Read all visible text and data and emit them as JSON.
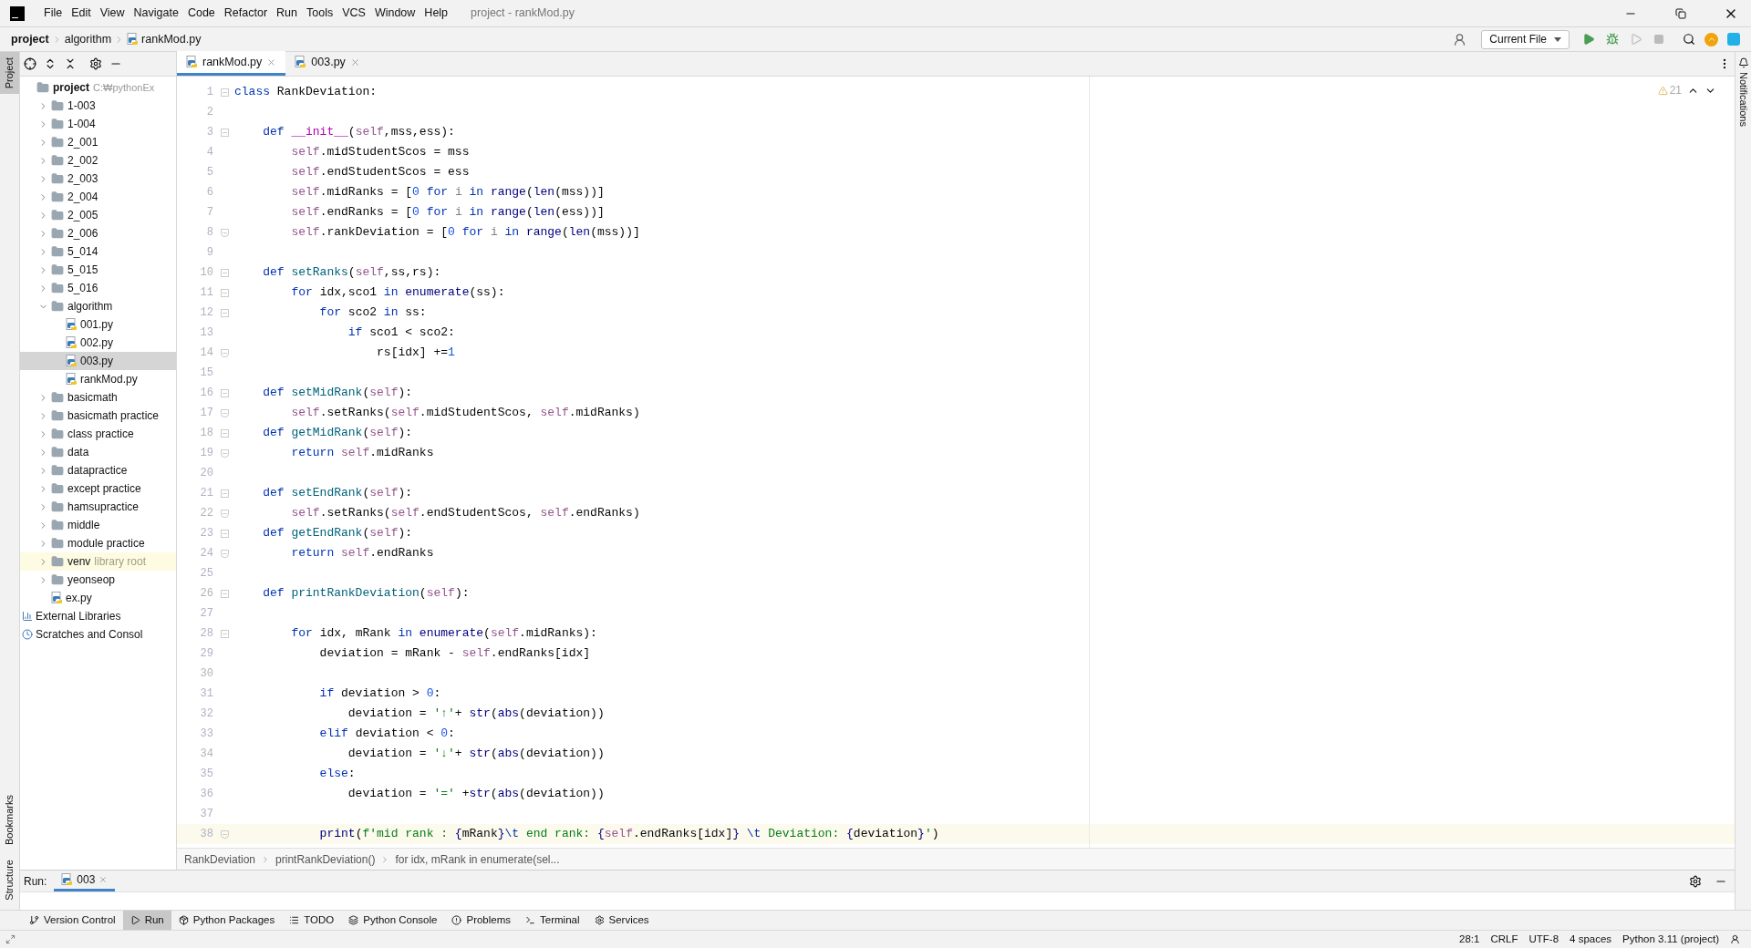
{
  "title_bar": {
    "menu": [
      "File",
      "Edit",
      "View",
      "Navigate",
      "Code",
      "Refactor",
      "Run",
      "Tools",
      "VCS",
      "Window",
      "Help"
    ],
    "title": "project - rankMod.py"
  },
  "nav_bar": {
    "breadcrumbs": [
      "project",
      "algorithm",
      "rankMod.py"
    ],
    "run_config": "Current File"
  },
  "left_strip": {
    "top": [
      "Project"
    ],
    "bottom": [
      "Bookmarks",
      "Structure"
    ]
  },
  "project_tree": {
    "label": "project",
    "path": "C:₩pythonEx",
    "children": [
      {
        "kind": "folder",
        "label": "1-003",
        "expanded": false,
        "selected": false
      },
      {
        "kind": "folder",
        "label": "1-004",
        "expanded": false,
        "selected": false
      },
      {
        "kind": "folder",
        "label": "2_001",
        "expanded": false,
        "selected": false
      },
      {
        "kind": "folder",
        "label": "2_002",
        "expanded": false,
        "selected": false
      },
      {
        "kind": "folder",
        "label": "2_003",
        "expanded": false,
        "selected": false
      },
      {
        "kind": "folder",
        "label": "2_004",
        "expanded": false,
        "selected": false
      },
      {
        "kind": "folder",
        "label": "2_005",
        "expanded": false,
        "selected": false
      },
      {
        "kind": "folder",
        "label": "2_006",
        "expanded": false,
        "selected": false
      },
      {
        "kind": "folder",
        "label": "5_014",
        "expanded": false,
        "selected": false
      },
      {
        "kind": "folder",
        "label": "5_015",
        "expanded": false,
        "selected": false
      },
      {
        "kind": "folder",
        "label": "5_016",
        "expanded": false,
        "selected": false
      },
      {
        "kind": "folder",
        "label": "algorithm",
        "expanded": true,
        "selected": false,
        "children": [
          {
            "kind": "file",
            "label": "001.py",
            "selected": false
          },
          {
            "kind": "file",
            "label": "002.py",
            "selected": false
          },
          {
            "kind": "file",
            "label": "003.py",
            "selected": true
          },
          {
            "kind": "file",
            "label": "rankMod.py",
            "selected": false
          }
        ]
      },
      {
        "kind": "folder",
        "label": "basicmath",
        "expanded": false,
        "selected": false
      },
      {
        "kind": "folder",
        "label": "basicmath practice",
        "expanded": false,
        "selected": false
      },
      {
        "kind": "folder",
        "label": "class practice",
        "expanded": false,
        "selected": false
      },
      {
        "kind": "folder",
        "label": "data",
        "expanded": false,
        "selected": false
      },
      {
        "kind": "folder",
        "label": "datapractice",
        "expanded": false,
        "selected": false
      },
      {
        "kind": "folder",
        "label": "except practice",
        "expanded": false,
        "selected": false
      },
      {
        "kind": "folder",
        "label": "hamsupractice",
        "expanded": false,
        "selected": false
      },
      {
        "kind": "folder",
        "label": "middle",
        "expanded": false,
        "selected": false
      },
      {
        "kind": "folder",
        "label": "module practice",
        "expanded": false,
        "selected": false
      },
      {
        "kind": "folder",
        "label": "venv",
        "note": "library root",
        "expanded": false,
        "selected": false
      },
      {
        "kind": "folder",
        "label": "yeonseop",
        "expanded": false,
        "selected": false
      },
      {
        "kind": "file",
        "label": "ex.py",
        "selected": false
      }
    ]
  },
  "extra_tree": [
    {
      "kind": "libraries",
      "label": "External Libraries"
    },
    {
      "kind": "scratches",
      "label": "Scratches and Consol"
    }
  ],
  "tabs": [
    {
      "label": "rankMod.py",
      "selected": true
    },
    {
      "label": "003.py",
      "selected": false
    }
  ],
  "editor": {
    "warnings": "21",
    "lines": [
      {
        "n": "1",
        "kind": "foldstart",
        "tokens": [
          {
            "kind": "keyword",
            "text": "class"
          },
          {
            "kind": "plain",
            "text": " RankDeviation:"
          }
        ]
      },
      {
        "n": "2",
        "kind": "blank"
      },
      {
        "n": "3",
        "kind": "foldstart",
        "tokens": [
          {
            "kind": "keyword",
            "text": "    def"
          },
          {
            "kind": "magic",
            "text": " __init__"
          },
          {
            "kind": "plain",
            "text": "("
          },
          {
            "kind": "self",
            "text": "self"
          },
          {
            "kind": "plain",
            "text": ",mss,ess):"
          }
        ]
      },
      {
        "n": "4",
        "kind": "plain",
        "tokens": [
          {
            "kind": "self",
            "text": "        self"
          },
          {
            "kind": "plain",
            "text": ".midStudentScos = mss"
          }
        ]
      },
      {
        "n": "5",
        "kind": "plain",
        "tokens": [
          {
            "kind": "self",
            "text": "        self"
          },
          {
            "kind": "plain",
            "text": ".endStudentScos = ess"
          }
        ]
      },
      {
        "n": "6",
        "kind": "plain",
        "tokens": [
          {
            "kind": "self",
            "text": "        self"
          },
          {
            "kind": "plain",
            "text": ".midRanks = ["
          },
          {
            "kind": "number",
            "text": "0"
          },
          {
            "kind": "keyword",
            "text": " for"
          },
          {
            "kind": "unused",
            "text": " i"
          },
          {
            "kind": "keyword",
            "text": " in"
          },
          {
            "kind": "builtin",
            "text": " range"
          },
          {
            "kind": "plain",
            "text": "("
          },
          {
            "kind": "builtin",
            "text": "len"
          },
          {
            "kind": "plain",
            "text": "(mss))]"
          }
        ]
      },
      {
        "n": "7",
        "kind": "plain",
        "tokens": [
          {
            "kind": "self",
            "text": "        self"
          },
          {
            "kind": "plain",
            "text": ".endRanks = ["
          },
          {
            "kind": "number",
            "text": "0"
          },
          {
            "kind": "keyword",
            "text": " for"
          },
          {
            "kind": "unused",
            "text": " i"
          },
          {
            "kind": "keyword",
            "text": " in"
          },
          {
            "kind": "builtin",
            "text": " range"
          },
          {
            "kind": "plain",
            "text": "("
          },
          {
            "kind": "builtin",
            "text": "len"
          },
          {
            "kind": "plain",
            "text": "(ess))]"
          }
        ]
      },
      {
        "n": "8",
        "kind": "foldend",
        "tokens": [
          {
            "kind": "self",
            "text": "        self"
          },
          {
            "kind": "plain",
            "text": ".rankDeviation = ["
          },
          {
            "kind": "number",
            "text": "0"
          },
          {
            "kind": "keyword",
            "text": " for"
          },
          {
            "kind": "unused",
            "text": " i"
          },
          {
            "kind": "keyword",
            "text": " in"
          },
          {
            "kind": "builtin",
            "text": " range"
          },
          {
            "kind": "plain",
            "text": "("
          },
          {
            "kind": "builtin",
            "text": "len"
          },
          {
            "kind": "plain",
            "text": "(mss))]"
          }
        ]
      },
      {
        "n": "9",
        "kind": "blank"
      },
      {
        "n": "10",
        "kind": "foldstart",
        "tokens": [
          {
            "kind": "keyword",
            "text": "    def"
          },
          {
            "kind": "function",
            "text": " setRanks"
          },
          {
            "kind": "plain",
            "text": "("
          },
          {
            "kind": "self",
            "text": "self"
          },
          {
            "kind": "plain",
            "text": ",ss,rs):"
          }
        ]
      },
      {
        "n": "11",
        "kind": "foldstart",
        "tokens": [
          {
            "kind": "keyword",
            "text": "        for"
          },
          {
            "kind": "plain",
            "text": " idx,sco1 "
          },
          {
            "kind": "keyword",
            "text": "in"
          },
          {
            "kind": "builtin",
            "text": " enumerate"
          },
          {
            "kind": "plain",
            "text": "(ss):"
          }
        ]
      },
      {
        "n": "12",
        "kind": "foldstart",
        "tokens": [
          {
            "kind": "keyword",
            "text": "            for"
          },
          {
            "kind": "plain",
            "text": " sco2 "
          },
          {
            "kind": "keyword",
            "text": "in"
          },
          {
            "kind": "plain",
            "text": " ss:"
          }
        ]
      },
      {
        "n": "13",
        "kind": "plain",
        "tokens": [
          {
            "kind": "keyword",
            "text": "                if"
          },
          {
            "kind": "plain",
            "text": " sco1 < sco2:"
          }
        ]
      },
      {
        "n": "14",
        "kind": "foldend",
        "tokens": [
          {
            "kind": "plain",
            "text": "                    rs[idx] +="
          },
          {
            "kind": "number",
            "text": "1"
          }
        ]
      },
      {
        "n": "15",
        "kind": "blank"
      },
      {
        "n": "16",
        "kind": "foldstart",
        "tokens": [
          {
            "kind": "keyword",
            "text": "    def"
          },
          {
            "kind": "function",
            "text": " setMidRank"
          },
          {
            "kind": "plain",
            "text": "("
          },
          {
            "kind": "self",
            "text": "self"
          },
          {
            "kind": "plain",
            "text": "):"
          }
        ]
      },
      {
        "n": "17",
        "kind": "foldend",
        "tokens": [
          {
            "kind": "self",
            "text": "        self"
          },
          {
            "kind": "plain",
            "text": ".setRanks("
          },
          {
            "kind": "self",
            "text": "self"
          },
          {
            "kind": "plain",
            "text": ".midStudentScos,"
          },
          {
            "kind": "self",
            "text": " self"
          },
          {
            "kind": "plain",
            "text": ".midRanks)"
          }
        ]
      },
      {
        "n": "18",
        "kind": "foldstart",
        "tokens": [
          {
            "kind": "keyword",
            "text": "    def"
          },
          {
            "kind": "function",
            "text": " getMidRank"
          },
          {
            "kind": "plain",
            "text": "("
          },
          {
            "kind": "self",
            "text": "self"
          },
          {
            "kind": "plain",
            "text": "):"
          }
        ]
      },
      {
        "n": "19",
        "kind": "foldend",
        "tokens": [
          {
            "kind": "keyword",
            "text": "        return"
          },
          {
            "kind": "self",
            "text": " self"
          },
          {
            "kind": "plain",
            "text": ".midRanks"
          }
        ]
      },
      {
        "n": "20",
        "kind": "blank"
      },
      {
        "n": "21",
        "kind": "foldstart",
        "tokens": [
          {
            "kind": "keyword",
            "text": "    def"
          },
          {
            "kind": "function",
            "text": " setEndRank"
          },
          {
            "kind": "plain",
            "text": "("
          },
          {
            "kind": "self",
            "text": "self"
          },
          {
            "kind": "plain",
            "text": "):"
          }
        ]
      },
      {
        "n": "22",
        "kind": "foldend",
        "tokens": [
          {
            "kind": "self",
            "text": "        self"
          },
          {
            "kind": "plain",
            "text": ".setRanks("
          },
          {
            "kind": "self",
            "text": "self"
          },
          {
            "kind": "plain",
            "text": ".endStudentScos,"
          },
          {
            "kind": "self",
            "text": " self"
          },
          {
            "kind": "plain",
            "text": ".endRanks)"
          }
        ]
      },
      {
        "n": "23",
        "kind": "foldstart",
        "tokens": [
          {
            "kind": "keyword",
            "text": "    def"
          },
          {
            "kind": "function",
            "text": " getEndRank"
          },
          {
            "kind": "plain",
            "text": "("
          },
          {
            "kind": "self",
            "text": "self"
          },
          {
            "kind": "plain",
            "text": "):"
          }
        ]
      },
      {
        "n": "24",
        "kind": "foldend",
        "tokens": [
          {
            "kind": "keyword",
            "text": "        return"
          },
          {
            "kind": "self",
            "text": " self"
          },
          {
            "kind": "plain",
            "text": ".endRanks"
          }
        ]
      },
      {
        "n": "25",
        "kind": "blank"
      },
      {
        "n": "26",
        "kind": "foldstart",
        "tokens": [
          {
            "kind": "keyword",
            "text": "    def"
          },
          {
            "kind": "function",
            "text": " printRankDeviation"
          },
          {
            "kind": "plain",
            "text": "("
          },
          {
            "kind": "self",
            "text": "self"
          },
          {
            "kind": "plain",
            "text": "):"
          }
        ]
      },
      {
        "n": "27",
        "kind": "blank"
      },
      {
        "n": "28",
        "kind": "foldstart",
        "tokens": [
          {
            "kind": "keyword",
            "text": "        for"
          },
          {
            "kind": "plain",
            "text": " idx, mRank "
          },
          {
            "kind": "keyword",
            "text": "in"
          },
          {
            "kind": "builtin",
            "text": " enumerate"
          },
          {
            "kind": "plain",
            "text": "("
          },
          {
            "kind": "self",
            "text": "self"
          },
          {
            "kind": "plain",
            "text": ".midRanks):"
          }
        ]
      },
      {
        "n": "29",
        "kind": "plain",
        "tokens": [
          {
            "kind": "plain",
            "text": "            deviation = mRank -"
          },
          {
            "kind": "self",
            "text": " self"
          },
          {
            "kind": "plain",
            "text": ".endRanks[idx]"
          }
        ]
      },
      {
        "n": "30",
        "kind": "blank"
      },
      {
        "n": "31",
        "kind": "plain",
        "tokens": [
          {
            "kind": "keyword",
            "text": "            if"
          },
          {
            "kind": "plain",
            "text": " deviation > "
          },
          {
            "kind": "number",
            "text": "0"
          },
          {
            "kind": "plain",
            "text": ":"
          }
        ]
      },
      {
        "n": "32",
        "kind": "plain",
        "tokens": [
          {
            "kind": "plain",
            "text": "                deviation = "
          },
          {
            "kind": "string",
            "text": "'↑'"
          },
          {
            "kind": "plain",
            "text": "+"
          },
          {
            "kind": "builtin",
            "text": " str"
          },
          {
            "kind": "plain",
            "text": "("
          },
          {
            "kind": "builtin",
            "text": "abs"
          },
          {
            "kind": "plain",
            "text": "(deviation))"
          }
        ]
      },
      {
        "n": "33",
        "kind": "plain",
        "tokens": [
          {
            "kind": "keyword",
            "text": "            elif"
          },
          {
            "kind": "plain",
            "text": " deviation < "
          },
          {
            "kind": "number",
            "text": "0"
          },
          {
            "kind": "plain",
            "text": ":"
          }
        ]
      },
      {
        "n": "34",
        "kind": "plain",
        "tokens": [
          {
            "kind": "plain",
            "text": "                deviation = "
          },
          {
            "kind": "string",
            "text": "'↓'"
          },
          {
            "kind": "plain",
            "text": "+"
          },
          {
            "kind": "builtin",
            "text": " str"
          },
          {
            "kind": "plain",
            "text": "("
          },
          {
            "kind": "builtin",
            "text": "abs"
          },
          {
            "kind": "plain",
            "text": "(deviation))"
          }
        ]
      },
      {
        "n": "35",
        "kind": "plain",
        "tokens": [
          {
            "kind": "keyword",
            "text": "            else"
          },
          {
            "kind": "plain",
            "text": ":"
          }
        ]
      },
      {
        "n": "36",
        "kind": "plain",
        "tokens": [
          {
            "kind": "plain",
            "text": "                deviation = "
          },
          {
            "kind": "string",
            "text": "'='"
          },
          {
            "kind": "plain",
            "text": " +"
          },
          {
            "kind": "builtin",
            "text": "str"
          },
          {
            "kind": "plain",
            "text": "("
          },
          {
            "kind": "builtin",
            "text": "abs"
          },
          {
            "kind": "plain",
            "text": "(deviation))"
          }
        ]
      },
      {
        "n": "37",
        "kind": "blank"
      },
      {
        "n": "38",
        "kind": "foldend",
        "current": true,
        "tokens": [
          {
            "kind": "builtin",
            "text": "            print"
          },
          {
            "kind": "plain",
            "text": "("
          },
          {
            "kind": "string",
            "text": "f'mid rank : "
          },
          {
            "kind": "builtin",
            "text": "{"
          },
          {
            "kind": "plain",
            "text": "mRank"
          },
          {
            "kind": "builtin",
            "text": "}"
          },
          {
            "kind": "keyword",
            "text": "\\t"
          },
          {
            "kind": "string",
            "text": " end rank: "
          },
          {
            "kind": "builtin",
            "text": "{"
          },
          {
            "kind": "self",
            "text": "self"
          },
          {
            "kind": "plain",
            "text": ".endRanks[idx]"
          },
          {
            "kind": "builtin",
            "text": "}"
          },
          {
            "kind": "keyword",
            "text": " \\t"
          },
          {
            "kind": "string",
            "text": " Deviation: "
          },
          {
            "kind": "builtin",
            "text": "{"
          },
          {
            "kind": "plain",
            "text": "deviation"
          },
          {
            "kind": "builtin",
            "text": "}"
          },
          {
            "kind": "string",
            "text": "'"
          },
          {
            "kind": "plain",
            "text": ")"
          }
        ]
      }
    ],
    "breadcrumbs": [
      "RankDeviation",
      "printRankDeviation()",
      "for idx, mRank in enumerate(sel..."
    ]
  },
  "right_strip": [
    "Notifications"
  ],
  "run_panel": {
    "label": "Run:",
    "tab": "003"
  },
  "tool_buttons": [
    {
      "kind": "vcs",
      "label": "Version Control",
      "selected": false
    },
    {
      "kind": "run",
      "label": "Run",
      "selected": true
    },
    {
      "kind": "packages",
      "label": "Python Packages",
      "selected": false
    },
    {
      "kind": "todo",
      "label": "TODO",
      "selected": false
    },
    {
      "kind": "console",
      "label": "Python Console",
      "selected": false
    },
    {
      "kind": "problems",
      "label": "Problems",
      "selected": false
    },
    {
      "kind": "terminal",
      "label": "Terminal",
      "selected": false
    },
    {
      "kind": "services",
      "label": "Services",
      "selected": false
    }
  ],
  "status_bar": [
    "28:1",
    "CRLF",
    "UTF-8",
    "4 spaces",
    "Python 3.11 (project)"
  ]
}
